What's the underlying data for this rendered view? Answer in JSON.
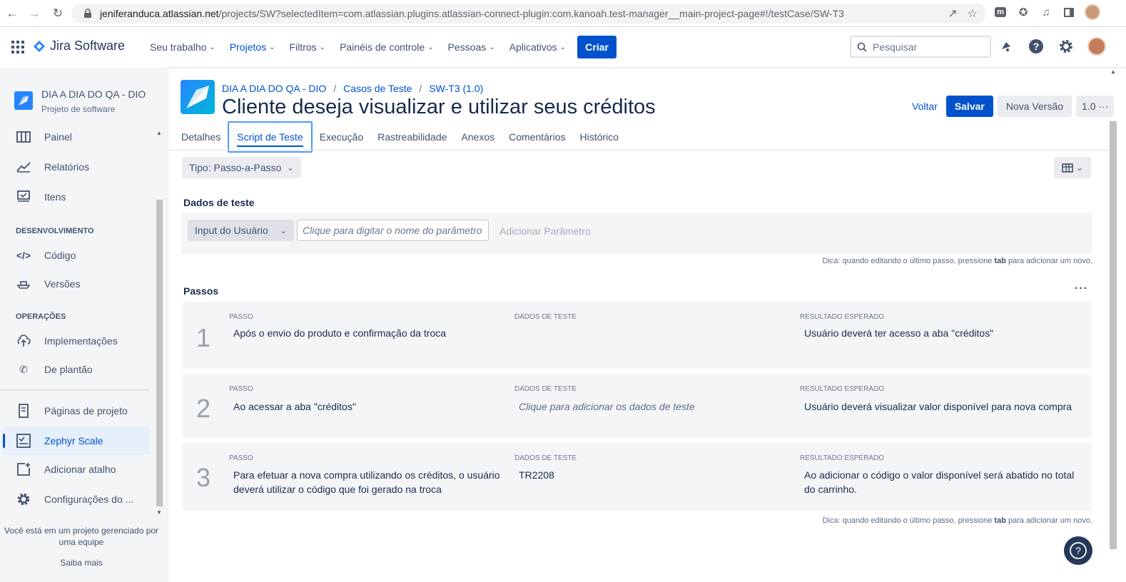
{
  "browser": {
    "url_host": "jeniferanduca.atlassian.net",
    "url_path": "/projects/SW?selectedItem=com.atlassian.plugins.atlassian-connect-plugin:com.kanoah.test-manager__main-project-page#!/testCase/SW-T3"
  },
  "topnav": {
    "product": "Jira Software",
    "menu": [
      {
        "label": "Seu trabalho"
      },
      {
        "label": "Projetos"
      },
      {
        "label": "Filtros"
      },
      {
        "label": "Painéis de controle"
      },
      {
        "label": "Pessoas"
      },
      {
        "label": "Aplicativos"
      }
    ],
    "create_label": "Criar",
    "search_placeholder": "Pesquisar"
  },
  "sidebar": {
    "project_name": "DIA A DIA DO QA - DIO",
    "project_type": "Projeto de software",
    "items": {
      "painel": "Painel",
      "relatorios": "Relatórios",
      "itens": "Itens",
      "dev_section": "DESENVOLVIMENTO",
      "codigo": "Código",
      "versoes": "Versões",
      "ops_section": "OPERAÇÕES",
      "implementacoes": "Implementações",
      "plantao": "De plantão",
      "paginas": "Páginas de projeto",
      "zephyr": "Zephyr Scale",
      "atalho": "Adicionar atalho",
      "config": "Configurações do ..."
    },
    "footer_text": "Você está em um projeto gerenciado por uma equipe",
    "learn_more": "Saiba mais"
  },
  "main": {
    "breadcrumb": [
      "DIA A DIA DO QA - DIO",
      "Casos de Teste",
      "SW-T3 (1.0)"
    ],
    "title": "Cliente deseja visualizar e utilizar seus créditos",
    "actions": {
      "back": "Voltar",
      "save": "Salvar",
      "new_version": "Nova Versão",
      "version": "1.0 ···"
    },
    "tabs": [
      "Detalhes",
      "Script de Teste",
      "Execução",
      "Rastreabilidade",
      "Anexos",
      "Comentários",
      "Histórico"
    ],
    "type_dropdown": "Tipo: Passo-a-Passo",
    "test_data_title": "Dados de teste",
    "input_type": "Input do Usuário",
    "param_placeholder": "Clique para digitar o nome do parâmetro",
    "add_param": "Adicionar Parâmetro",
    "hint_prefix": "Dica: quando editando o último passo, pressione",
    "hint_key": "tab",
    "hint_suffix": "para adicionar um novo.",
    "steps_title": "Passos",
    "col_labels": {
      "step": "PASSO",
      "data": "DADOS DE TESTE",
      "result": "RESULTADO ESPERADO"
    },
    "steps": [
      {
        "num": "1",
        "step": "Após o envio do produto e confirmação da troca",
        "data": "",
        "result": "Usuário deverá ter acesso a aba \"créditos\""
      },
      {
        "num": "2",
        "step": "Ao acessar a aba \"créditos\"",
        "data": "Clique para adicionar os dados de teste",
        "result": "Usuário deverá visualizar valor disponível para nova compra"
      },
      {
        "num": "3",
        "step": "Para efetuar a nova compra utilizando os créditos, o usuário deverá utilizar o código que foi gerado na troca",
        "data": "TR2208",
        "result": "Ao adicionar o código o valor disponível será abatido no total do carrinho."
      }
    ]
  }
}
